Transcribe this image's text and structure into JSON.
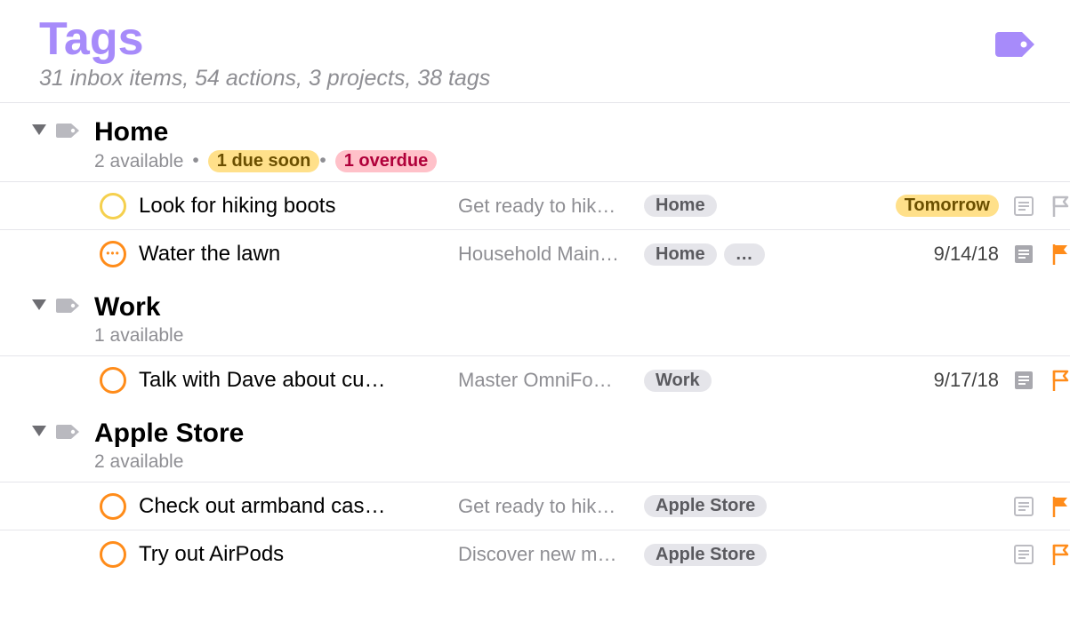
{
  "header": {
    "title": "Tags",
    "subtitle": "31 inbox items, 54 actions, 3 projects, 38 tags"
  },
  "colors": {
    "accent": "#a78bfa",
    "orange": "#ff8c1a"
  },
  "groups": [
    {
      "name": "Home",
      "available": "2 available",
      "badges": [
        {
          "text": "1 due soon",
          "style": "yellow"
        },
        {
          "text": "1 overdue",
          "style": "red"
        }
      ],
      "tasks": [
        {
          "title": "Look for hiking boots",
          "project_trunc": "Get ready to hik…",
          "tags": [
            {
              "text": "Home",
              "style": "grey"
            }
          ],
          "due": {
            "text": "Tomorrow",
            "style": "yellow-pill"
          },
          "status": "yellow",
          "status_dots": false,
          "note": "outline",
          "flag": "outline"
        },
        {
          "title": "Water the lawn",
          "project_trunc": "Household Main…",
          "tags": [
            {
              "text": "Home",
              "style": "grey"
            },
            {
              "text": "…",
              "style": "grey"
            }
          ],
          "due": {
            "text": "9/14/18",
            "style": "plain"
          },
          "status": "orange",
          "status_dots": true,
          "note": "filled",
          "flag": "filled"
        }
      ]
    },
    {
      "name": "Work",
      "available": "1 available",
      "badges": [],
      "tasks": [
        {
          "title": "Talk with Dave about cu…",
          "project_trunc": "Master OmniFo…",
          "tags": [
            {
              "text": "Work",
              "style": "grey"
            }
          ],
          "due": {
            "text": "9/17/18",
            "style": "plain"
          },
          "status": "orange",
          "status_dots": false,
          "note": "filled",
          "flag": "outline-orange"
        }
      ]
    },
    {
      "name": "Apple Store",
      "available": "2 available",
      "badges": [],
      "tasks": [
        {
          "title": "Check out armband cas…",
          "project_trunc": "Get ready to hik…",
          "tags": [
            {
              "text": "Apple Store",
              "style": "grey"
            }
          ],
          "due": {
            "text": "",
            "style": "plain"
          },
          "status": "orange",
          "status_dots": false,
          "note": "outline",
          "flag": "filled"
        },
        {
          "title": "Try out AirPods",
          "project_trunc": "Discover new m…",
          "tags": [
            {
              "text": "Apple Store",
              "style": "grey"
            }
          ],
          "due": {
            "text": "",
            "style": "plain"
          },
          "status": "orange",
          "status_dots": false,
          "note": "outline",
          "flag": "outline-orange"
        }
      ]
    }
  ]
}
